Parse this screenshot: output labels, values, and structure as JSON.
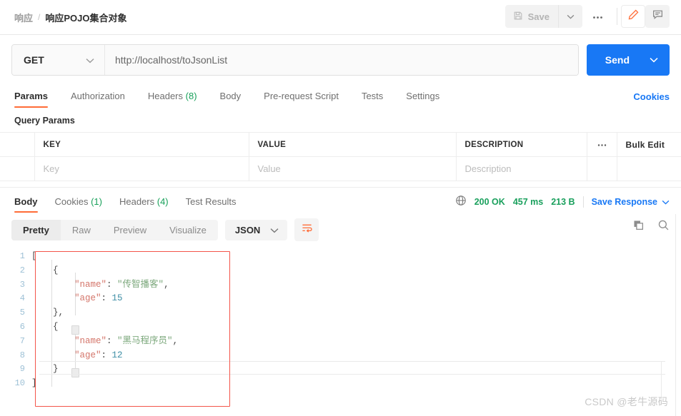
{
  "header": {
    "breadcrumb_parent": "响应",
    "breadcrumb_separator": "/",
    "breadcrumb_current": "响应POJO集合对象",
    "save_label": "Save"
  },
  "request": {
    "method": "GET",
    "url": "http://localhost/toJsonList",
    "send_label": "Send",
    "tabs": [
      {
        "label": "Params",
        "count": "",
        "active": true
      },
      {
        "label": "Authorization",
        "count": "",
        "active": false
      },
      {
        "label": "Headers",
        "count": "(8)",
        "active": false
      },
      {
        "label": "Body",
        "count": "",
        "active": false
      },
      {
        "label": "Pre-request Script",
        "count": "",
        "active": false
      },
      {
        "label": "Tests",
        "count": "",
        "active": false
      },
      {
        "label": "Settings",
        "count": "",
        "active": false
      }
    ],
    "cookies_link": "Cookies",
    "query_params_label": "Query Params"
  },
  "params_table": {
    "headers": [
      "KEY",
      "VALUE",
      "DESCRIPTION"
    ],
    "bulk_edit_label": "Bulk Edit",
    "rows": [
      {
        "key": "Key",
        "value": "Value",
        "description": "Description"
      }
    ]
  },
  "response": {
    "tabs": [
      {
        "label": "Body",
        "count": "",
        "active": true
      },
      {
        "label": "Cookies",
        "count": "(1)",
        "active": false
      },
      {
        "label": "Headers",
        "count": "(4)",
        "active": false
      },
      {
        "label": "Test Results",
        "count": "",
        "active": false
      }
    ],
    "status": "200 OK",
    "time": "457 ms",
    "size": "213 B",
    "save_response_label": "Save Response",
    "view_modes": [
      {
        "label": "Pretty",
        "active": true
      },
      {
        "label": "Raw",
        "active": false
      },
      {
        "label": "Preview",
        "active": false
      },
      {
        "label": "Visualize",
        "active": false
      }
    ],
    "format": "JSON"
  },
  "body_code": {
    "lines": [
      {
        "n": "1",
        "indent": 0,
        "segments": [
          {
            "t": "punct",
            "s": "["
          }
        ]
      },
      {
        "n": "2",
        "indent": 1,
        "segments": [
          {
            "t": "punct",
            "s": "{"
          }
        ]
      },
      {
        "n": "3",
        "indent": 2,
        "segments": [
          {
            "t": "key",
            "s": "\"name\""
          },
          {
            "t": "punct",
            "s": ": "
          },
          {
            "t": "str",
            "s": "\"传智播客\""
          },
          {
            "t": "punct",
            "s": ","
          }
        ]
      },
      {
        "n": "4",
        "indent": 2,
        "segments": [
          {
            "t": "key",
            "s": "\"age\""
          },
          {
            "t": "punct",
            "s": ": "
          },
          {
            "t": "num",
            "s": "15"
          }
        ]
      },
      {
        "n": "5",
        "indent": 1,
        "segments": [
          {
            "t": "punct",
            "s": "},"
          }
        ]
      },
      {
        "n": "6",
        "indent": 1,
        "segments": [
          {
            "t": "punct",
            "s": "{"
          }
        ]
      },
      {
        "n": "7",
        "indent": 2,
        "segments": [
          {
            "t": "key",
            "s": "\"name\""
          },
          {
            "t": "punct",
            "s": ": "
          },
          {
            "t": "str",
            "s": "\"黑马程序员\""
          },
          {
            "t": "punct",
            "s": ","
          }
        ]
      },
      {
        "n": "8",
        "indent": 2,
        "segments": [
          {
            "t": "key",
            "s": "\"age\""
          },
          {
            "t": "punct",
            "s": ": "
          },
          {
            "t": "num",
            "s": "12"
          }
        ]
      },
      {
        "n": "9",
        "indent": 1,
        "segments": [
          {
            "t": "punct",
            "s": "}"
          }
        ]
      },
      {
        "n": "10",
        "indent": 0,
        "segments": [
          {
            "t": "punct",
            "s": "]"
          }
        ]
      }
    ]
  },
  "watermark": "CSDN @老牛源码",
  "colors": {
    "accent_orange": "#ff6c37",
    "send_blue": "#1878f5",
    "status_green": "#1aa05d",
    "annotation_red": "#f4554a",
    "json_key": "#d4756a",
    "json_string": "#7ca87c",
    "json_number": "#3f8fa6"
  }
}
